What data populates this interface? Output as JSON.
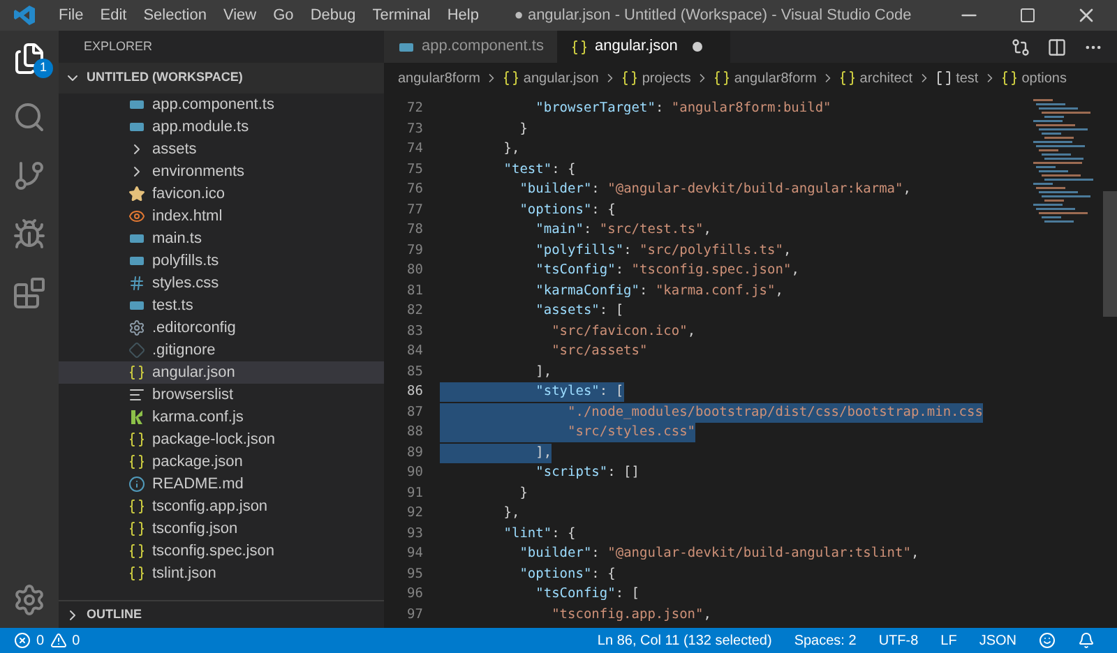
{
  "window": {
    "title": "● angular.json - Untitled (Workspace) - Visual Studio Code"
  },
  "menu": [
    "File",
    "Edit",
    "Selection",
    "View",
    "Go",
    "Debug",
    "Terminal",
    "Help"
  ],
  "activity_bar": {
    "explorer_badge": "1"
  },
  "sidebar": {
    "title": "EXPLORER",
    "workspace": {
      "label": "UNTITLED (WORKSPACE)",
      "expanded": true
    },
    "items": [
      {
        "kind": "ts",
        "label": "app.component.ts",
        "selected": false
      },
      {
        "kind": "ts",
        "label": "app.module.ts",
        "selected": false
      },
      {
        "kind": "folder",
        "label": "assets",
        "selected": false
      },
      {
        "kind": "folder",
        "label": "environments",
        "selected": false
      },
      {
        "kind": "star",
        "label": "favicon.ico",
        "selected": false
      },
      {
        "kind": "html",
        "label": "index.html",
        "selected": false
      },
      {
        "kind": "ts",
        "label": "main.ts",
        "selected": false
      },
      {
        "kind": "ts",
        "label": "polyfills.ts",
        "selected": false
      },
      {
        "kind": "css",
        "label": "styles.css",
        "selected": false
      },
      {
        "kind": "ts",
        "label": "test.ts",
        "selected": false
      },
      {
        "kind": "config",
        "label": ".editorconfig",
        "selected": false
      },
      {
        "kind": "git",
        "label": ".gitignore",
        "selected": false
      },
      {
        "kind": "json",
        "label": "angular.json",
        "selected": true
      },
      {
        "kind": "list",
        "label": "browserslist",
        "selected": false
      },
      {
        "kind": "karma",
        "label": "karma.conf.js",
        "selected": false
      },
      {
        "kind": "json",
        "label": "package-lock.json",
        "selected": false
      },
      {
        "kind": "json",
        "label": "package.json",
        "selected": false
      },
      {
        "kind": "info",
        "label": "README.md",
        "selected": false
      },
      {
        "kind": "json",
        "label": "tsconfig.app.json",
        "selected": false
      },
      {
        "kind": "json",
        "label": "tsconfig.json",
        "selected": false
      },
      {
        "kind": "json",
        "label": "tsconfig.spec.json",
        "selected": false
      },
      {
        "kind": "json",
        "label": "tslint.json",
        "selected": false
      }
    ],
    "outline": {
      "label": "OUTLINE",
      "expanded": false
    }
  },
  "tabs": [
    {
      "kind": "ts",
      "label": "app.component.ts",
      "selected": false
    },
    {
      "kind": "json",
      "label": "angular.json",
      "selected": true,
      "dirty": true
    }
  ],
  "breadcrumb": [
    {
      "label": "angular8form"
    },
    {
      "kind": "object",
      "label": "angular.json"
    },
    {
      "kind": "object",
      "label": "projects"
    },
    {
      "kind": "object",
      "label": "angular8form"
    },
    {
      "kind": "object",
      "label": "architect"
    },
    {
      "kind": "array",
      "label": "test"
    },
    {
      "kind": "object",
      "label": "options"
    }
  ],
  "code": [
    {
      "number": "72",
      "selected": false,
      "tokens": [
        {
          "kind": "key",
          "text": "            \"browserTarget\""
        },
        {
          "kind": "punct",
          "text": ": "
        },
        {
          "kind": "string",
          "text": "\"angular8form:build\""
        }
      ]
    },
    {
      "number": "73",
      "selected": false,
      "tokens": [
        {
          "kind": "punct",
          "text": "          }"
        }
      ]
    },
    {
      "number": "74",
      "selected": false,
      "tokens": [
        {
          "kind": "punct",
          "text": "        },"
        }
      ]
    },
    {
      "number": "75",
      "selected": false,
      "tokens": [
        {
          "kind": "key",
          "text": "        \"test\""
        },
        {
          "kind": "punct",
          "text": ": {"
        }
      ]
    },
    {
      "number": "76",
      "selected": false,
      "tokens": [
        {
          "kind": "key",
          "text": "          \"builder\""
        },
        {
          "kind": "punct",
          "text": ": "
        },
        {
          "kind": "string",
          "text": "\"@angular-devkit/build-angular:karma\""
        },
        {
          "kind": "punct",
          "text": ","
        }
      ]
    },
    {
      "number": "77",
      "selected": false,
      "tokens": [
        {
          "kind": "key",
          "text": "          \"options\""
        },
        {
          "kind": "punct",
          "text": ": {"
        }
      ]
    },
    {
      "number": "78",
      "selected": false,
      "tokens": [
        {
          "kind": "key",
          "text": "            \"main\""
        },
        {
          "kind": "punct",
          "text": ": "
        },
        {
          "kind": "string",
          "text": "\"src/test.ts\""
        },
        {
          "kind": "punct",
          "text": ","
        }
      ]
    },
    {
      "number": "79",
      "selected": false,
      "tokens": [
        {
          "kind": "key",
          "text": "            \"polyfills\""
        },
        {
          "kind": "punct",
          "text": ": "
        },
        {
          "kind": "string",
          "text": "\"src/polyfills.ts\""
        },
        {
          "kind": "punct",
          "text": ","
        }
      ]
    },
    {
      "number": "80",
      "selected": false,
      "tokens": [
        {
          "kind": "key",
          "text": "            \"tsConfig\""
        },
        {
          "kind": "punct",
          "text": ": "
        },
        {
          "kind": "string",
          "text": "\"tsconfig.spec.json\""
        },
        {
          "kind": "punct",
          "text": ","
        }
      ]
    },
    {
      "number": "81",
      "selected": false,
      "tokens": [
        {
          "kind": "key",
          "text": "            \"karmaConfig\""
        },
        {
          "kind": "punct",
          "text": ": "
        },
        {
          "kind": "string",
          "text": "\"karma.conf.js\""
        },
        {
          "kind": "punct",
          "text": ","
        }
      ]
    },
    {
      "number": "82",
      "selected": false,
      "tokens": [
        {
          "kind": "key",
          "text": "            \"assets\""
        },
        {
          "kind": "punct",
          "text": ": ["
        }
      ]
    },
    {
      "number": "83",
      "selected": false,
      "tokens": [
        {
          "kind": "string",
          "text": "              \"src/favicon.ico\""
        },
        {
          "kind": "punct",
          "text": ","
        }
      ]
    },
    {
      "number": "84",
      "selected": false,
      "tokens": [
        {
          "kind": "string",
          "text": "              \"src/assets\""
        }
      ]
    },
    {
      "number": "85",
      "selected": false,
      "tokens": [
        {
          "kind": "punct",
          "text": "            ],"
        }
      ]
    },
    {
      "number": "86",
      "selected": true,
      "tokens": [
        {
          "kind": "key",
          "text": "            \"styles\""
        },
        {
          "kind": "punct",
          "text": ": ["
        }
      ]
    },
    {
      "number": "87",
      "selected": true,
      "tokens": [
        {
          "kind": "string",
          "text": "                \"./node_modules/bootstrap/dist/css/bootstrap.min.css"
        }
      ]
    },
    {
      "number": "88",
      "selected": true,
      "tokens": [
        {
          "kind": "string",
          "text": "                \"src/styles.css\""
        }
      ]
    },
    {
      "number": "89",
      "selected": true,
      "tokens": [
        {
          "kind": "punct",
          "text": "            ],"
        }
      ]
    },
    {
      "number": "90",
      "selected": false,
      "tokens": [
        {
          "kind": "key",
          "text": "            \"scripts\""
        },
        {
          "kind": "punct",
          "text": ": []"
        }
      ]
    },
    {
      "number": "91",
      "selected": false,
      "tokens": [
        {
          "kind": "punct",
          "text": "          }"
        }
      ]
    },
    {
      "number": "92",
      "selected": false,
      "tokens": [
        {
          "kind": "punct",
          "text": "        },"
        }
      ]
    },
    {
      "number": "93",
      "selected": false,
      "tokens": [
        {
          "kind": "key",
          "text": "        \"lint\""
        },
        {
          "kind": "punct",
          "text": ": {"
        }
      ]
    },
    {
      "number": "94",
      "selected": false,
      "tokens": [
        {
          "kind": "key",
          "text": "          \"builder\""
        },
        {
          "kind": "punct",
          "text": ": "
        },
        {
          "kind": "string",
          "text": "\"@angular-devkit/build-angular:tslint\""
        },
        {
          "kind": "punct",
          "text": ","
        }
      ]
    },
    {
      "number": "95",
      "selected": false,
      "tokens": [
        {
          "kind": "key",
          "text": "          \"options\""
        },
        {
          "kind": "punct",
          "text": ": {"
        }
      ]
    },
    {
      "number": "96",
      "selected": false,
      "tokens": [
        {
          "kind": "key",
          "text": "            \"tsConfig\""
        },
        {
          "kind": "punct",
          "text": ": ["
        }
      ]
    },
    {
      "number": "97",
      "selected": false,
      "tokens": [
        {
          "kind": "string",
          "text": "              \"tsconfig.app.json\""
        },
        {
          "kind": "punct",
          "text": ","
        }
      ]
    }
  ],
  "status_bar": {
    "errors": "0",
    "warnings": "0",
    "items": [
      "Ln 86, Col 11 (132 selected)",
      "Spaces: 2",
      "UTF-8",
      "LF",
      "JSON"
    ]
  }
}
